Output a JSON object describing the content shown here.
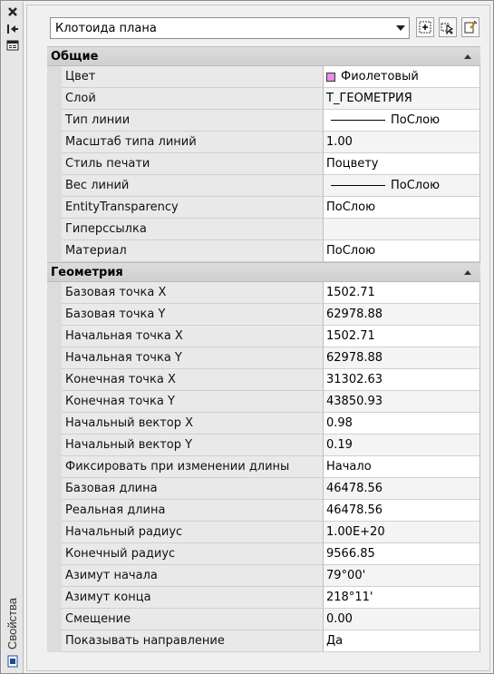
{
  "palette": {
    "title": "Свойства",
    "object_type": "Клотоида плана"
  },
  "colors": {
    "purple_swatch": "#e68de6",
    "category_bg": "#d4d4d4"
  },
  "categories": [
    {
      "title": "Общие",
      "rows": [
        {
          "name": "Цвет",
          "value": "Фиолетовый",
          "kind": "color"
        },
        {
          "name": "Слой",
          "value": "Т_ГЕОМЕТРИЯ",
          "kind": "text"
        },
        {
          "name": "Тип линии",
          "value": "ПоСлою",
          "kind": "line"
        },
        {
          "name": "Масштаб типа линий",
          "value": "1.00",
          "kind": "text"
        },
        {
          "name": "Стиль печати",
          "value": "Поцвету",
          "kind": "text"
        },
        {
          "name": "Вес линий",
          "value": "ПоСлою",
          "kind": "line"
        },
        {
          "name": "EntityTransparency",
          "value": "ПоСлою",
          "kind": "text"
        },
        {
          "name": "Гиперссылка",
          "value": "",
          "kind": "text"
        },
        {
          "name": "Материал",
          "value": "ПоСлою",
          "kind": "text"
        }
      ]
    },
    {
      "title": "Геометрия",
      "rows": [
        {
          "name": "Базовая точка X",
          "value": "1502.71",
          "kind": "text"
        },
        {
          "name": "Базовая точка Y",
          "value": "62978.88",
          "kind": "text"
        },
        {
          "name": "Начальная точка X",
          "value": "1502.71",
          "kind": "text"
        },
        {
          "name": "Начальная точка Y",
          "value": "62978.88",
          "kind": "text"
        },
        {
          "name": "Конечная точка X",
          "value": "31302.63",
          "kind": "text"
        },
        {
          "name": "Конечная точка Y",
          "value": "43850.93",
          "kind": "text"
        },
        {
          "name": "Начальный вектор X",
          "value": "0.98",
          "kind": "text"
        },
        {
          "name": "Начальный вектор Y",
          "value": "0.19",
          "kind": "text"
        },
        {
          "name": "Фиксировать при изменении длины",
          "value": "Начало",
          "kind": "text"
        },
        {
          "name": "Базовая длина",
          "value": "46478.56",
          "kind": "text"
        },
        {
          "name": "Реальная длина",
          "value": "46478.56",
          "kind": "text"
        },
        {
          "name": "Начальный радиус",
          "value": "1.00E+20",
          "kind": "text"
        },
        {
          "name": "Конечный радиус",
          "value": "9566.85",
          "kind": "text"
        },
        {
          "name": "Азимут начала",
          "value": "79°00'",
          "kind": "text"
        },
        {
          "name": "Азимут конца",
          "value": "218°11'",
          "kind": "text"
        },
        {
          "name": "Смещение",
          "value": "0.00",
          "kind": "text"
        },
        {
          "name": "Показывать направление",
          "value": "Да",
          "kind": "text"
        }
      ]
    }
  ]
}
